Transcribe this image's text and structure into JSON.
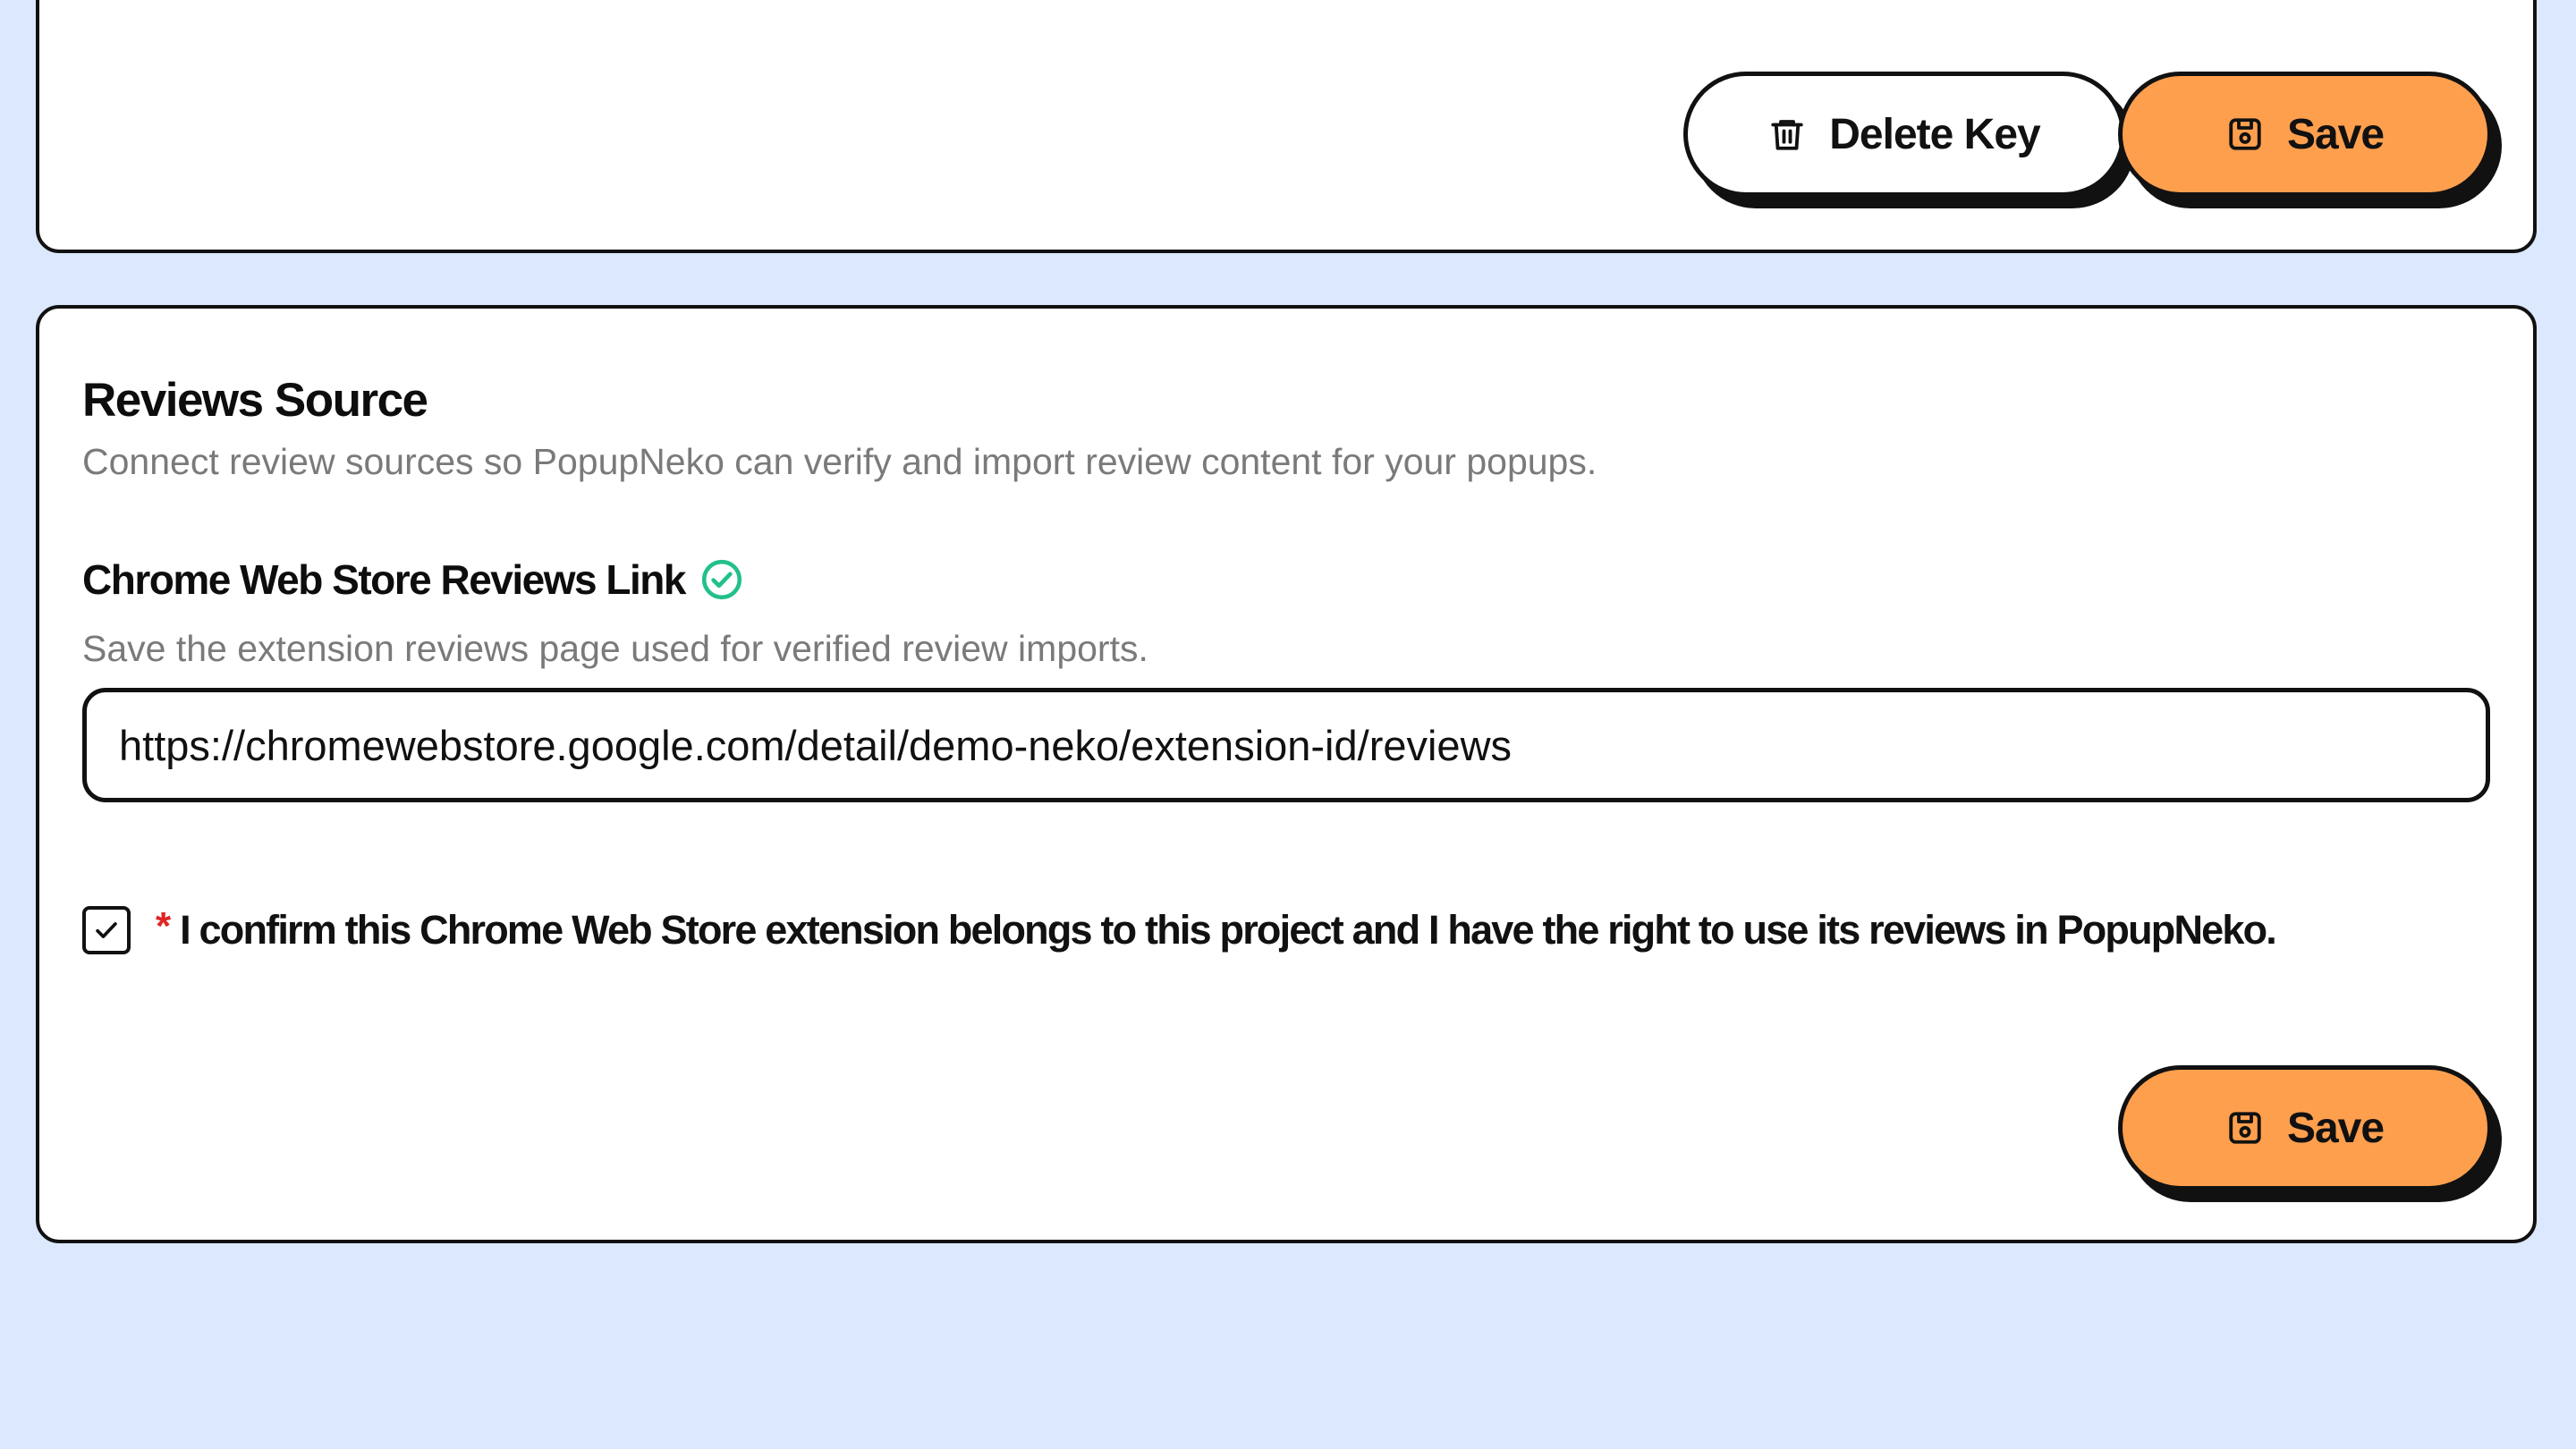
{
  "top_card": {
    "delete_key_label": "Delete Key",
    "save_label": "Save"
  },
  "reviews_source": {
    "title": "Reviews Source",
    "description": "Connect review sources so PopupNeko can verify and import review content for your popups.",
    "chrome_link": {
      "label": "Chrome Web Store Reviews Link",
      "verified_icon": "check-circle-icon",
      "help": "Save the extension reviews page used for verified review imports.",
      "value": "https://chromewebstore.google.com/detail/demo-neko/extension-id/reviews"
    },
    "confirm": {
      "checked": true,
      "required_mark": "*",
      "text": "I confirm this Chrome Web Store extension belongs to this project and I have the right to use its reviews in PopupNeko."
    },
    "save_label": "Save"
  },
  "colors": {
    "page_background": "#dbe8fd",
    "accent_orange": "#fe9f4e",
    "verified_green": "#22c08a",
    "required_red": "#e02424",
    "border": "#111111"
  }
}
